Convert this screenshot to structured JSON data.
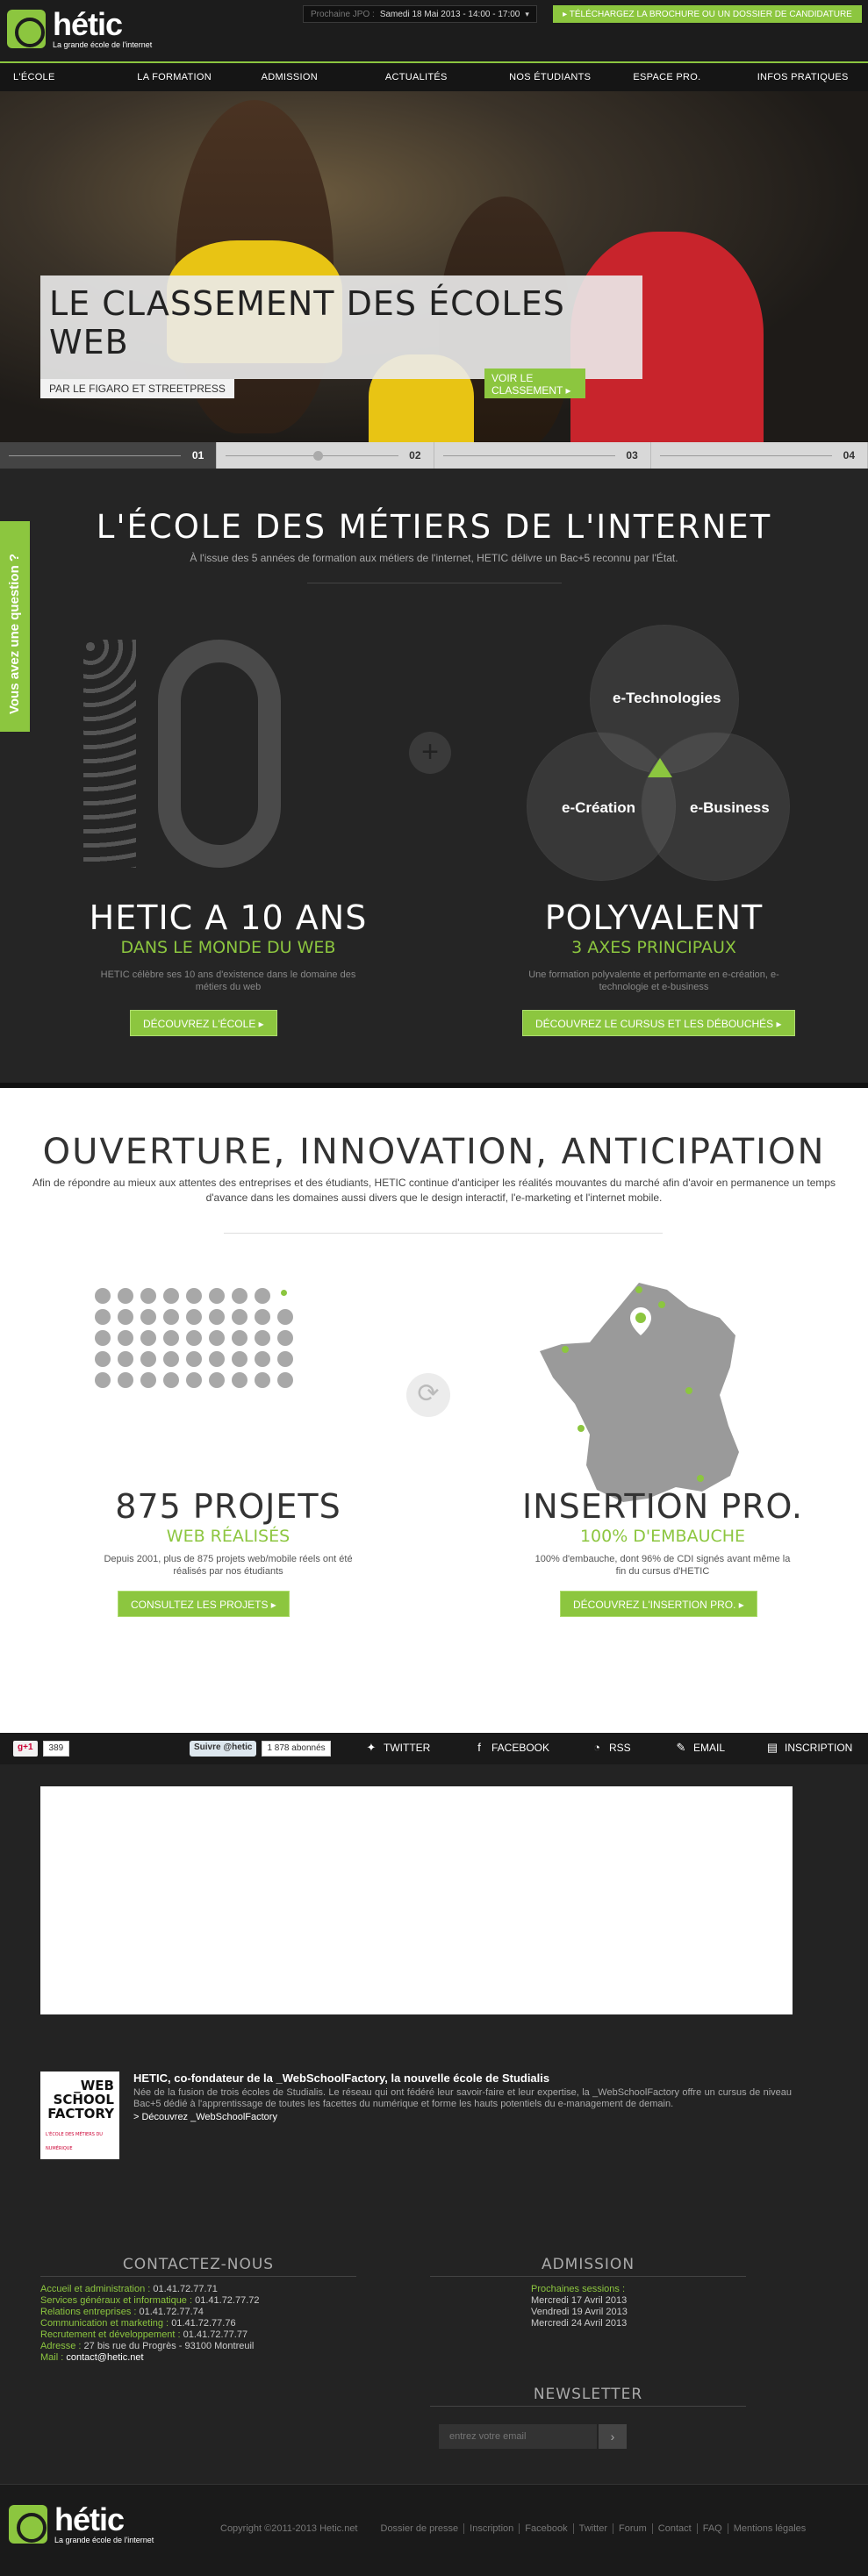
{
  "header": {
    "logo_name": "hétic",
    "logo_tagline": "La grande école de l'internet",
    "jpo_label": "Prochaine JPO :",
    "jpo_value": "Samedi 18 Mai 2013 - 14:00 - 17:00",
    "brochure_label": "▸ TÉLÉCHARGEZ LA BROCHURE OU UN DOSSIER DE CANDIDATURE"
  },
  "nav": [
    "L'ÉCOLE",
    "LA FORMATION",
    "ADMISSION",
    "ACTUALITÉS",
    "NOS ÉTUDIANTS",
    "ESPACE PRO.",
    "INFOS PRATIQUES"
  ],
  "hero": {
    "title": "LE CLASSEMENT DES ÉCOLES WEB",
    "subtitle": "PAR LE FIGARO ET STREETPRESS",
    "button": "VOIR LE CLASSEMENT ▸",
    "slides": [
      "01",
      "02",
      "03",
      "04"
    ],
    "active_slide": 1
  },
  "side_tab": "Vous avez une question ?",
  "ecole": {
    "title": "L'ÉCOLE DES MÉTIERS DE L'INTERNET",
    "lead": "À l'issue des 5 années de formation aux métiers de l'internet, HETIC délivre un Bac+5 reconnu par l'État.",
    "left": {
      "title": "HETIC A 10 ANS",
      "subtitle": "DANS LE MONDE DU WEB",
      "desc": "HETIC célèbre ses 10 ans d'existence dans le domaine des métiers du web",
      "button": "DÉCOUVREZ L'ÉCOLE ▸"
    },
    "right": {
      "title": "POLYVALENT",
      "subtitle": "3 AXES PRINCIPAUX",
      "desc": "Une formation polyvalente et performante en e-création, e-technologie et e-business",
      "button": "DÉCOUVREZ LE CURSUS ET LES DÉBOUCHÉS ▸"
    },
    "venn": [
      "e-Technologies",
      "e-Création",
      "e-Business"
    ]
  },
  "ouverture": {
    "title": "OUVERTURE, INNOVATION, ANTICIPATION",
    "lead": "Afin de répondre au mieux aux attentes des entreprises et des étudiants, HETIC continue d'anticiper les réalités mouvantes du marché afin d'avoir en permanence un temps d'avance dans les domaines aussi divers que le design interactif, l'e-marketing et l'internet mobile.",
    "left": {
      "title": "875 PROJETS",
      "subtitle": "WEB RÉALISÉS",
      "desc": "Depuis 2001, plus de 875 projets web/mobile réels ont été réalisés par nos étudiants",
      "button": "CONSULTEZ LES PROJETS ▸"
    },
    "right": {
      "title": "INSERTION PRO.",
      "subtitle": "100% D'EMBAUCHE",
      "desc": "100% d'embauche, dont 96% de CDI signés avant même la fin du cursus d'HETIC",
      "button": "DÉCOUVREZ L'INSERTION PRO. ▸"
    }
  },
  "social": {
    "gplus_label": "g+1",
    "gplus_count": "389",
    "twitter_follow": "Suivre @hetic",
    "twitter_count": "1 878 abonnés",
    "links": [
      "TWITTER",
      "FACEBOOK",
      "RSS",
      "EMAIL",
      "INSCRIPTION"
    ]
  },
  "wsf": {
    "logo_lines": [
      "_WEB",
      "SCHOOL",
      "FACTORY"
    ],
    "logo_sub": "L'ÉCOLE DES MÉTIERS DU NUMÉRIQUE",
    "title": "HETIC, co-fondateur de la _WebSchoolFactory, la nouvelle école de Studialis",
    "body": "Née de la fusion de trois écoles de Studialis. Le réseau qui ont fédéré leur savoir-faire et leur expertise, la _WebSchoolFactory offre un cursus de niveau Bac+5 dédié à l'apprentissage de toutes les facettes du numérique et forme les hauts potentiels du e-management de demain.",
    "link": "> Découvrez _WebSchoolFactory"
  },
  "contact": {
    "title": "CONTACTEZ-NOUS",
    "rows": [
      {
        "label": "Accueil et administration :",
        "value": "01.41.72.77.71"
      },
      {
        "label": "Services généraux et informatique :",
        "value": "01.41.72.77.72"
      },
      {
        "label": "Relations entreprises :",
        "value": "01.41.72.77.74"
      },
      {
        "label": "Communication et marketing :",
        "value": "01.41.72.77.76"
      },
      {
        "label": "Recrutement et développement :",
        "value": "01.41.72.77.77"
      },
      {
        "label": "Adresse :",
        "value": "27 bis rue du Progrès - 93100 Montreuil"
      },
      {
        "label": "Mail :",
        "value": "contact@hetic.net"
      }
    ]
  },
  "admission": {
    "title": "ADMISSION",
    "label": "Prochaines sessions :",
    "dates": [
      "Mercredi 17 Avril 2013",
      "Vendredi 19 Avril 2013",
      "Mercredi 24 Avril 2013"
    ]
  },
  "newsletter": {
    "title": "NEWSLETTER",
    "placeholder": "entrez votre email",
    "button": "›"
  },
  "footer": {
    "copyright": "Copyright ©2011-2013 Hetic.net",
    "links": [
      "Dossier de presse",
      "Inscription",
      "Facebook",
      "Twitter",
      "Forum",
      "Contact",
      "FAQ",
      "Mentions légales"
    ]
  },
  "colors": {
    "accent": "#8cc63f",
    "dark": "#222222"
  }
}
